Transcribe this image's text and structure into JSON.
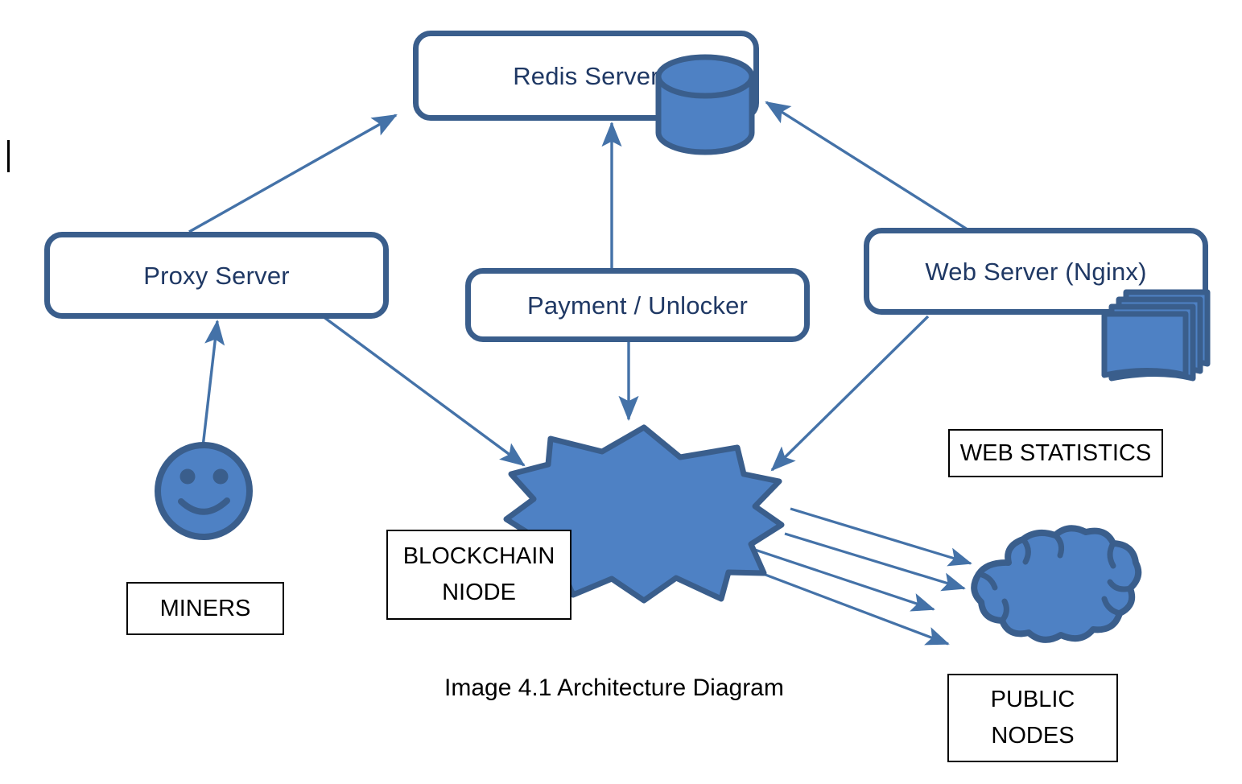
{
  "diagram": {
    "caption": "Image 4.1 Architecture Diagram",
    "colors": {
      "shape_fill": "#4E81C4",
      "shape_stroke": "#3A5E8C",
      "box_border": "#3A5E8C",
      "box_text": "#1F3864",
      "arrow": "#4472A8",
      "label_border": "#000000",
      "label_text": "#000000",
      "background": "#FFFFFF"
    },
    "nodes": [
      {
        "id": "redis",
        "label": "Redis Server",
        "type": "rounded-box",
        "icon": "database-cylinder-icon"
      },
      {
        "id": "proxy",
        "label": "Proxy Server",
        "type": "rounded-box",
        "icon": ""
      },
      {
        "id": "payment",
        "label": "Payment / Unlocker",
        "type": "rounded-box",
        "icon": ""
      },
      {
        "id": "webserver",
        "label": "Web Server (Nginx)",
        "type": "rounded-box",
        "icon": "stacked-documents-icon"
      },
      {
        "id": "blockchain",
        "label": "",
        "type": "explosion-shape",
        "icon": "explosion-icon"
      },
      {
        "id": "miners",
        "label": "",
        "type": "smiley-face",
        "icon": "smiley-face-icon"
      },
      {
        "id": "publicnodes",
        "label": "",
        "type": "cloud",
        "icon": "cloud-icon"
      }
    ],
    "labels": [
      {
        "id": "miners-label",
        "lines": [
          "MINERS"
        ]
      },
      {
        "id": "blockchain-label",
        "lines": [
          "BLOCKCHAIN",
          "NIODE"
        ]
      },
      {
        "id": "webstats-label",
        "lines": [
          "WEB STATISTICS"
        ]
      },
      {
        "id": "publicnodes-label",
        "lines": [
          "PUBLIC",
          "NODES"
        ]
      }
    ],
    "edges": [
      {
        "from": "proxy",
        "to": "redis",
        "direction": "to"
      },
      {
        "from": "payment",
        "to": "redis",
        "direction": "to"
      },
      {
        "from": "webserver",
        "to": "redis",
        "direction": "to"
      },
      {
        "from": "miners",
        "to": "proxy",
        "direction": "to"
      },
      {
        "from": "proxy",
        "to": "blockchain",
        "direction": "to"
      },
      {
        "from": "payment",
        "to": "blockchain",
        "direction": "to"
      },
      {
        "from": "webserver",
        "to": "blockchain",
        "direction": "to"
      },
      {
        "from": "blockchain",
        "to": "publicnodes",
        "direction": "to"
      },
      {
        "from": "blockchain",
        "to": "publicnodes",
        "direction": "to"
      },
      {
        "from": "blockchain",
        "to": "publicnodes",
        "direction": "to"
      },
      {
        "from": "blockchain",
        "to": "publicnodes",
        "direction": "to"
      }
    ]
  },
  "boxes": {
    "redis": {
      "label": "Redis Server"
    },
    "proxy": {
      "label": "Proxy Server"
    },
    "payment": {
      "label": "Payment / Unlocker"
    },
    "webserver": {
      "label": "Web Server (Nginx)"
    }
  },
  "labels": {
    "miners": {
      "line1": "MINERS"
    },
    "blockchain": {
      "line1": "BLOCKCHAIN",
      "line2": "NIODE"
    },
    "webstats": {
      "line1": "WEB STATISTICS"
    },
    "publicnodes": {
      "line1": "PUBLIC",
      "line2": "NODES"
    }
  },
  "caption": {
    "text": "Image 4.1 Architecture Diagram"
  }
}
